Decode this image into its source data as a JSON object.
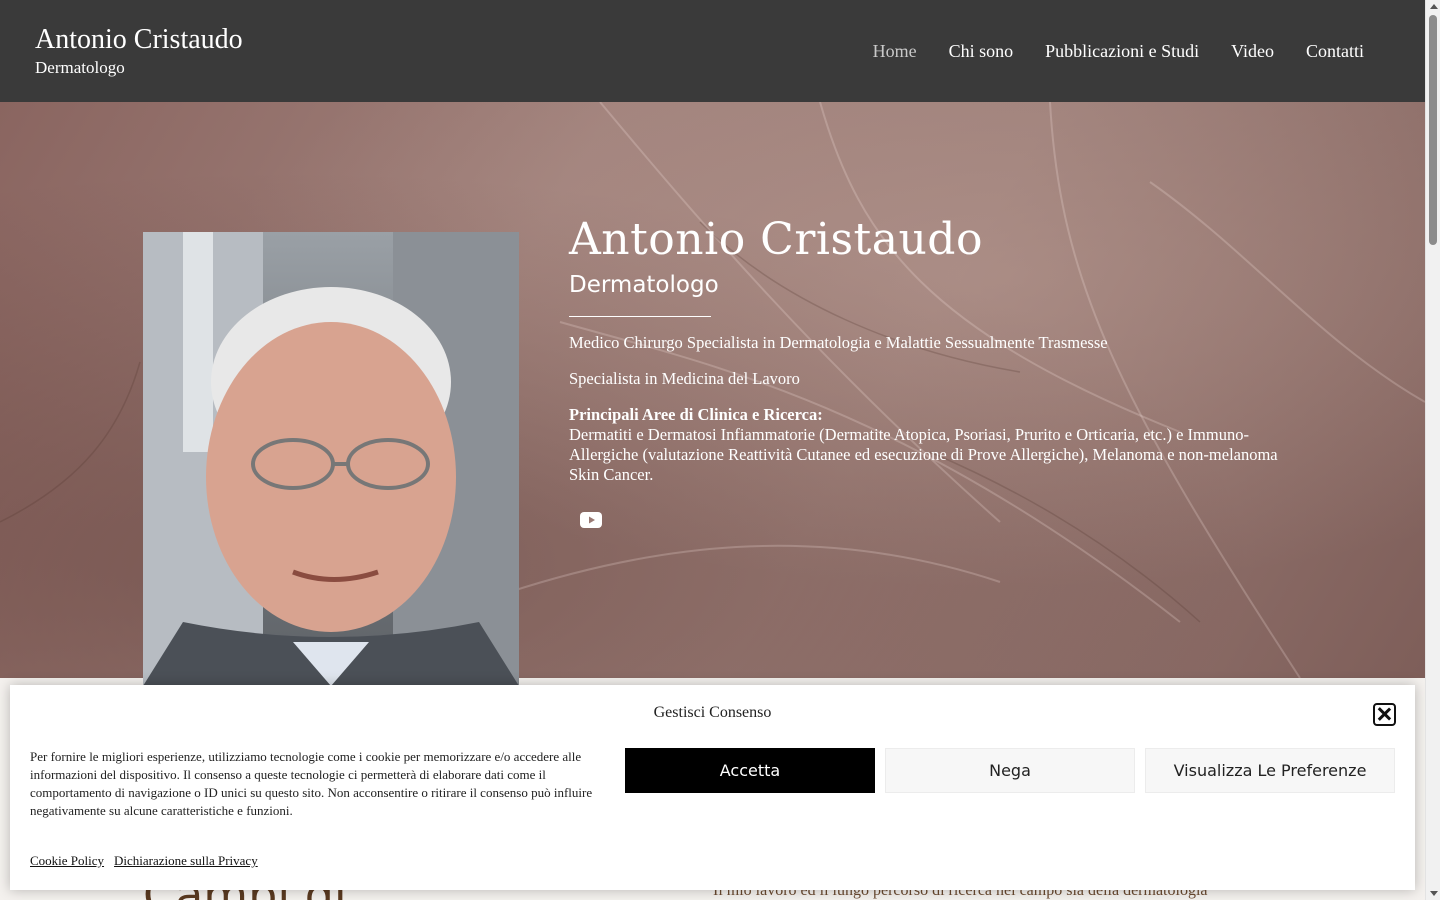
{
  "header": {
    "brand_name": "Antonio Cristaudo",
    "brand_sub": "Dermatologo",
    "nav": [
      {
        "label": "Home",
        "active": true
      },
      {
        "label": "Chi sono"
      },
      {
        "label": "Pubblicazioni e Studi"
      },
      {
        "label": "Video"
      },
      {
        "label": "Contatti"
      }
    ]
  },
  "hero": {
    "name": "Antonio Cristaudo",
    "role": "Dermatologo",
    "line1": "Medico Chirurgo Specialista in Dermatologia e Malattie Sessualmente Trasmesse",
    "line2": "Specialista in Medicina del Lavoro",
    "areas_title": "Principali Aree di Clinica e Ricerca:",
    "areas_text": "Dermatiti e Dermatosi Infiammatorie (Dermatite Atopica, Psoriasi, Prurito e Orticaria, etc.) e Immuno-Allergiche (valutazione Reattività Cutanee ed esecuzione di Prove Allergiche), Melanoma e non-melanoma Skin Cancer.",
    "social_icon": "youtube-icon"
  },
  "lower": {
    "title_partial": "Campi di",
    "text_partial": "Il mio lavoro ed il lungo percorso di ricerca nel campo sia della dermatologia"
  },
  "cookie": {
    "title": "Gestisci Consenso",
    "message": "Per fornire le migliori esperienze, utilizziamo tecnologie come i cookie per memorizzare e/o accedere alle informazioni del dispositivo. Il consenso a queste tecnologie ci permetterà di elaborare dati come il comportamento di navigazione o ID unici su questo sito. Non acconsentire o ritirare il consenso può influire negativamente su alcune caratteristiche e funzioni.",
    "accept_label": "Accetta",
    "deny_label": "Nega",
    "prefs_label": "Visualizza Le Preferenze",
    "link_cookie_policy": "Cookie Policy",
    "link_privacy": "Dichiarazione sulla Privacy"
  },
  "colors": {
    "header_bg": "#3a3a3a",
    "accept_bg": "#000000",
    "button_bg": "#f7f7f7"
  }
}
